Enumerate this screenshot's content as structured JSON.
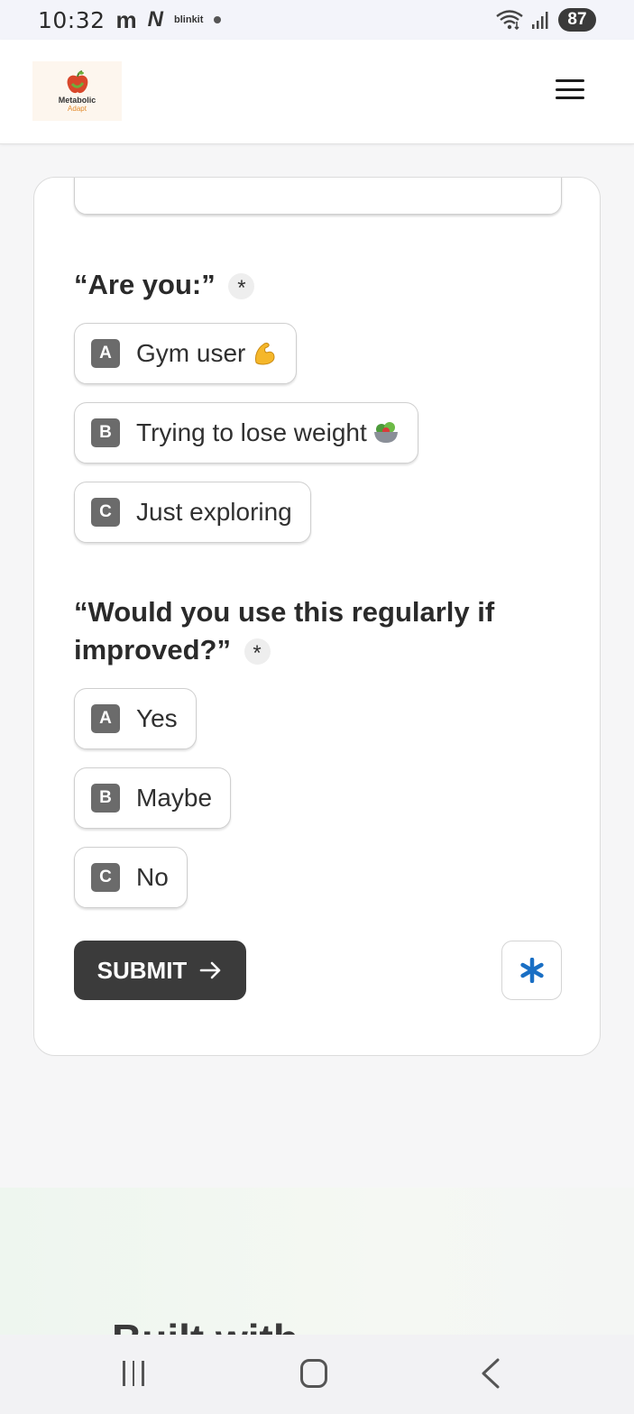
{
  "status_bar": {
    "time": "10:32",
    "app_icons": [
      "m",
      "N",
      "blinkit"
    ],
    "battery": "87"
  },
  "header": {
    "logo": {
      "line1": "Metabolic",
      "line2": "Adapt"
    }
  },
  "form": {
    "question1": {
      "text": "“Are you:”",
      "required_mark": "*",
      "options": [
        {
          "key": "A",
          "label": "Gym user"
        },
        {
          "key": "B",
          "label": "Trying to lose weight"
        },
        {
          "key": "C",
          "label": "Just exploring"
        }
      ]
    },
    "question2": {
      "text": "“Would you use this regularly if improved?”",
      "required_mark": "*",
      "options": [
        {
          "key": "A",
          "label": "Yes"
        },
        {
          "key": "B",
          "label": "Maybe"
        },
        {
          "key": "C",
          "label": "No"
        }
      ]
    },
    "submit_label": "SUBMIT",
    "brand_asterisk": "*"
  },
  "footer": {
    "partial_text": "Built with ..."
  },
  "colors": {
    "accent_asterisk": "#1a6fc4",
    "button_dark": "#3b3b3b"
  }
}
